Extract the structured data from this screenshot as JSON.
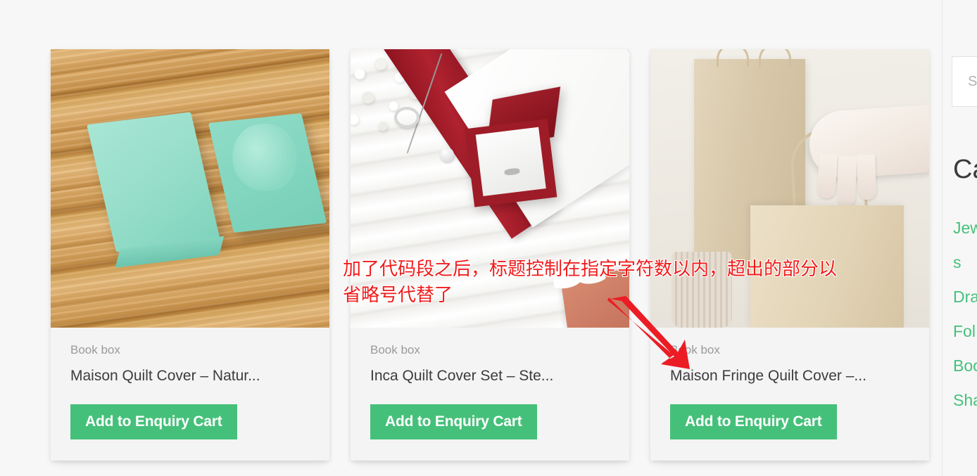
{
  "page": {
    "background_color": "#f7f7f7",
    "accent_green": "#45c07a",
    "annotation_color": "#f01c1c"
  },
  "products": [
    {
      "category": "Book box",
      "title": "Maison Quilt Cover – Natur...",
      "button_label": "Add to Enquiry Cart",
      "image_alt": "mint-gift-box-on-wooden-deck"
    },
    {
      "category": "Book box",
      "title": "Inca Quilt Cover Set – Ste...",
      "button_label": "Add to Enquiry Cart",
      "image_alt": "red-velvet-ring-box-jewellery-flatlay"
    },
    {
      "category": "Book box",
      "title": "Maison Fringe Quilt Cover –...",
      "button_label": "Add to Enquiry Cart",
      "image_alt": "kraft-paper-bags-held-by-gloved-hand"
    }
  ],
  "sidebar": {
    "search": {
      "placeholder": "Se",
      "value": ""
    },
    "categories_heading": "Ca",
    "categories": [
      {
        "label": "Jew"
      },
      {
        "label": "s"
      },
      {
        "label": "Dra"
      },
      {
        "label": "Fol"
      },
      {
        "label": "Boo"
      },
      {
        "label": "Sha"
      }
    ]
  },
  "annotation": {
    "text": "加了代码段之后，标题控制在指定字符数以内，超出的部分以\n省略号代替了",
    "arrow": "red-arrow-pointing-down-right"
  }
}
